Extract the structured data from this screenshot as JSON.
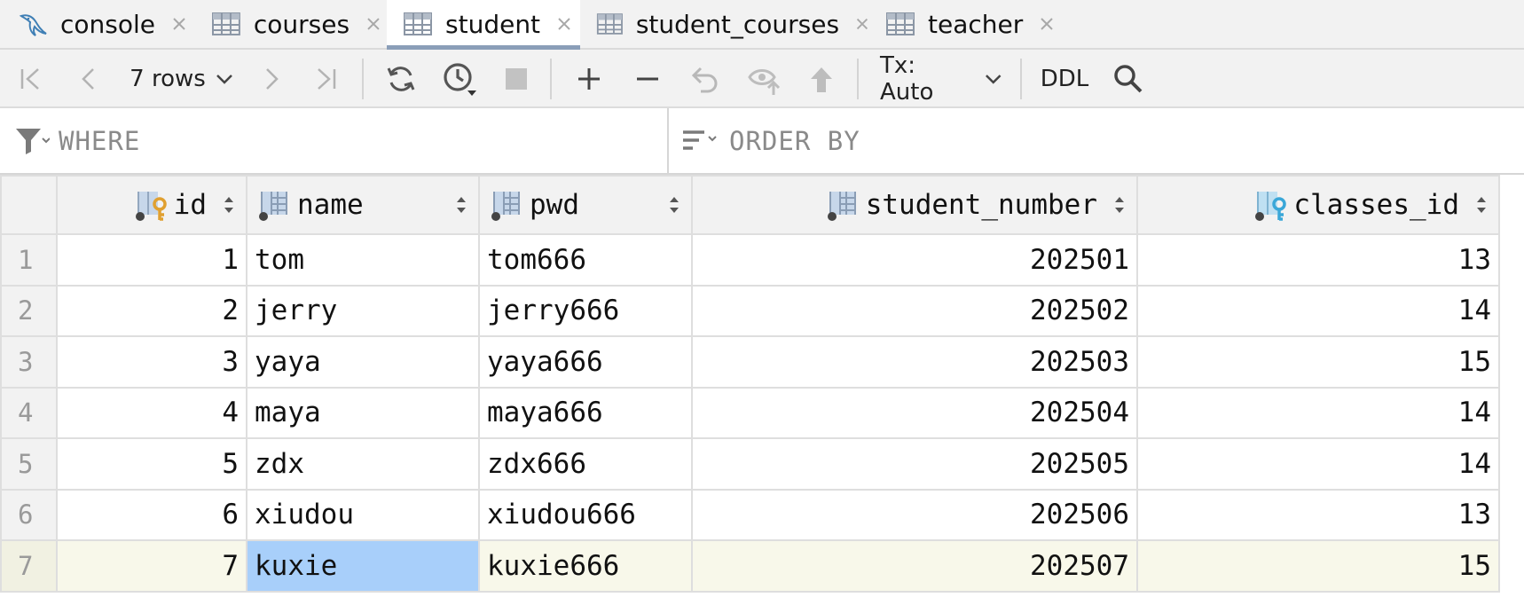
{
  "tabs": [
    {
      "label": "console",
      "icon": "mysql-dolphin-icon",
      "active": false
    },
    {
      "label": "courses",
      "icon": "table-icon",
      "active": false
    },
    {
      "label": "student",
      "icon": "table-icon",
      "active": true
    },
    {
      "label": "student_courses",
      "icon": "table-icon",
      "active": false
    },
    {
      "label": "teacher",
      "icon": "table-icon",
      "active": false
    }
  ],
  "toolbar": {
    "rows_label": "7 rows",
    "tx_label": "Tx: Auto",
    "ddl_label": "DDL"
  },
  "filter": {
    "where_placeholder": "WHERE",
    "order_placeholder": "ORDER BY"
  },
  "grid": {
    "columns": [
      {
        "name": "id",
        "icon": "primary-key-column-icon"
      },
      {
        "name": "name",
        "icon": "column-icon"
      },
      {
        "name": "pwd",
        "icon": "column-icon"
      },
      {
        "name": "student_number",
        "icon": "column-icon"
      },
      {
        "name": "classes_id",
        "icon": "foreign-key-column-icon"
      }
    ],
    "rows": [
      {
        "n": "1",
        "id": "1",
        "name": "tom",
        "pwd": "tom666",
        "student_number": "202501",
        "classes_id": "13"
      },
      {
        "n": "2",
        "id": "2",
        "name": "jerry",
        "pwd": "jerry666",
        "student_number": "202502",
        "classes_id": "14"
      },
      {
        "n": "3",
        "id": "3",
        "name": "yaya",
        "pwd": "yaya666",
        "student_number": "202503",
        "classes_id": "15"
      },
      {
        "n": "4",
        "id": "4",
        "name": "maya",
        "pwd": "maya666",
        "student_number": "202504",
        "classes_id": "14"
      },
      {
        "n": "5",
        "id": "5",
        "name": "zdx",
        "pwd": "zdx666",
        "student_number": "202505",
        "classes_id": "14"
      },
      {
        "n": "6",
        "id": "6",
        "name": "xiudou",
        "pwd": "xiudou666",
        "student_number": "202506",
        "classes_id": "13"
      },
      {
        "n": "7",
        "id": "7",
        "name": "kuxie",
        "pwd": "kuxie666",
        "student_number": "202507",
        "classes_id": "15"
      }
    ],
    "current_row": 7,
    "selected_cell": "name"
  },
  "colors": {
    "selection": "#a8cffa",
    "current_row": "#f8f8ea",
    "active_tab_underline": "#8a9eb8",
    "primary_key": "#e0a030",
    "foreign_key": "#3aa7d8"
  }
}
